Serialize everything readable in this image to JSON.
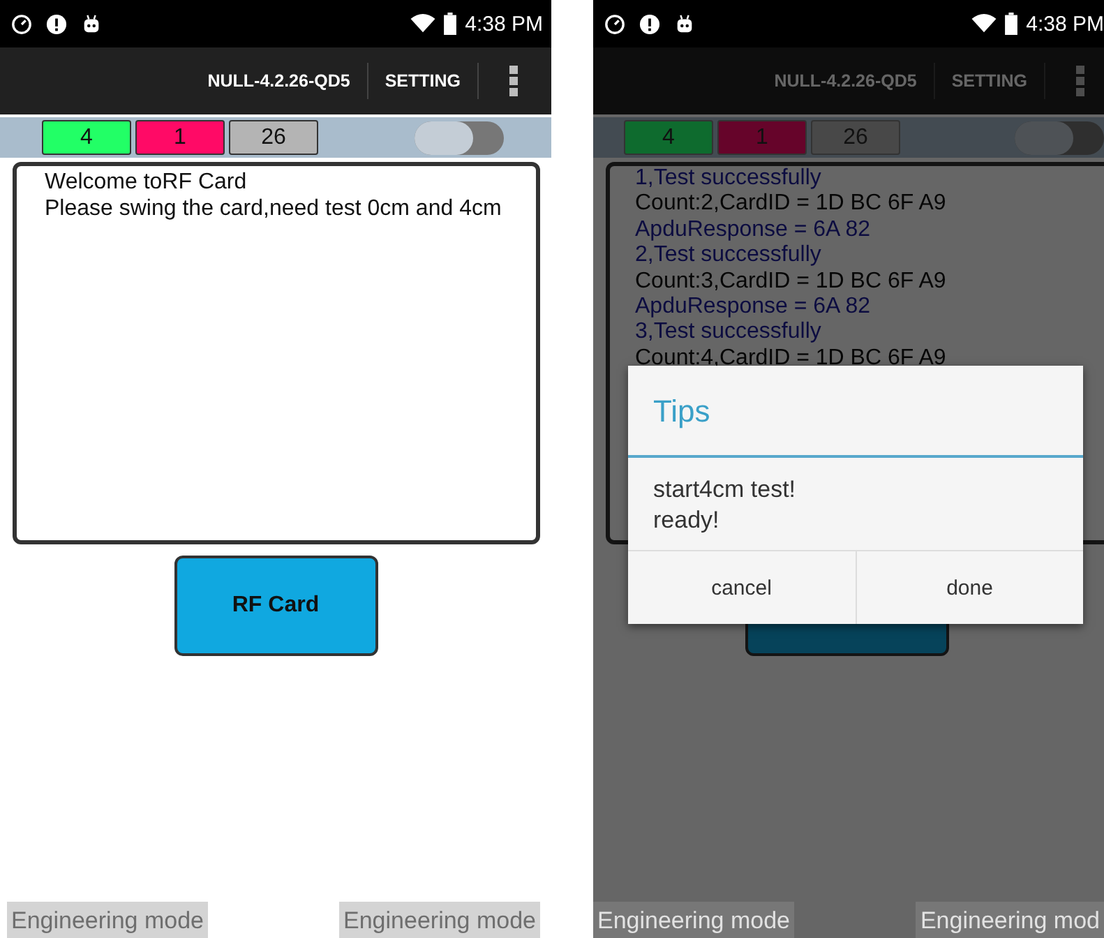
{
  "screens": [
    {
      "status_bar": {
        "time": "4:38 PM"
      },
      "action_bar": {
        "build": "NULL-4.2.26-QD5",
        "setting": "SETTING"
      },
      "counters": [
        {
          "label": "4",
          "color": "#22ff66"
        },
        {
          "label": "1",
          "color": "#ff0a66"
        },
        {
          "label": "26",
          "color": "#b4b4b4"
        }
      ],
      "toggle": {
        "on": false
      },
      "log": [
        {
          "text": "Welcome toRF Card",
          "kind": "plain"
        },
        {
          "text": "Please swing the card,need test 0cm and 4cm",
          "kind": "plain"
        }
      ],
      "button": {
        "label": "RF Card"
      },
      "footer": [
        "Engineering mode",
        "Engineering mode"
      ]
    },
    {
      "status_bar": {
        "time": "4:38 PM"
      },
      "action_bar": {
        "build": "NULL-4.2.26-QD5",
        "setting": "SETTING"
      },
      "counters": [
        {
          "label": "4",
          "color": "#0e6b2e"
        },
        {
          "label": "1",
          "color": "#66042a"
        },
        {
          "label": "26",
          "color": "#484848"
        }
      ],
      "toggle": {
        "on": false
      },
      "log": [
        {
          "text": "1,Test successfully",
          "kind": "status"
        },
        {
          "text": "Count:2,CardID = 1D BC 6F A9",
          "kind": "plain"
        },
        {
          "text": "ApduResponse = 6A 82",
          "kind": "status"
        },
        {
          "text": "2,Test successfully",
          "kind": "status"
        },
        {
          "text": "Count:3,CardID = 1D BC 6F A9",
          "kind": "plain"
        },
        {
          "text": "ApduResponse = 6A 82",
          "kind": "status"
        },
        {
          "text": "3,Test successfully",
          "kind": "status"
        },
        {
          "text": "Count:4,CardID = 1D BC 6F A9",
          "kind": "plain"
        }
      ],
      "dialog": {
        "title": "Tips",
        "message": [
          "start4cm test!",
          "ready!"
        ],
        "buttons": [
          "cancel",
          "done"
        ]
      },
      "footer": [
        "Engineering mode",
        "Engineering mod"
      ]
    }
  ]
}
